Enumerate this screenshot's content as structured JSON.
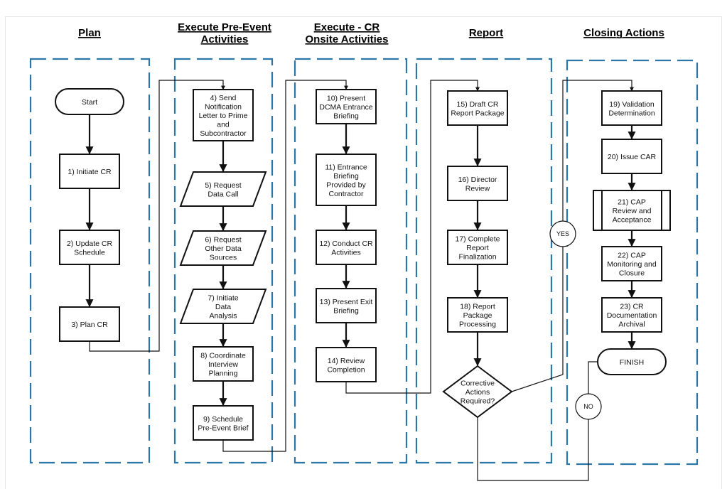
{
  "colors": {
    "lane_border": "#2a76a8",
    "line": "#111111",
    "background": "#ffffff"
  },
  "lanes": [
    {
      "id": "plan",
      "title_lines": [
        "Plan"
      ]
    },
    {
      "id": "pre-event",
      "title_lines": [
        "Execute Pre-Event",
        "Activities"
      ]
    },
    {
      "id": "onsite",
      "title_lines": [
        "Execute - CR",
        "Onsite Activities"
      ]
    },
    {
      "id": "report",
      "title_lines": [
        "Report"
      ]
    },
    {
      "id": "closing",
      "title_lines": [
        "Closing Actions"
      ]
    }
  ],
  "nodes": [
    {
      "id": "start",
      "lane": "plan",
      "shape": "terminator",
      "lines": [
        "Start"
      ]
    },
    {
      "id": "n1",
      "lane": "plan",
      "shape": "process",
      "lines": [
        "1) Initiate CR"
      ]
    },
    {
      "id": "n2",
      "lane": "plan",
      "shape": "process",
      "lines": [
        "2) Update CR",
        "Schedule"
      ]
    },
    {
      "id": "n3",
      "lane": "plan",
      "shape": "process",
      "lines": [
        "3) Plan CR"
      ]
    },
    {
      "id": "n4",
      "lane": "pre-event",
      "shape": "process",
      "lines": [
        "4) Send",
        "Notification",
        "Letter to Prime",
        "and",
        "Subcontractor"
      ]
    },
    {
      "id": "n5",
      "lane": "pre-event",
      "shape": "data",
      "lines": [
        "5) Request",
        "Data Call"
      ]
    },
    {
      "id": "n6",
      "lane": "pre-event",
      "shape": "data",
      "lines": [
        "6) Request",
        "Other Data",
        "Sources"
      ]
    },
    {
      "id": "n7",
      "lane": "pre-event",
      "shape": "data",
      "lines": [
        "7) Initiate",
        "Data",
        "Analysis"
      ]
    },
    {
      "id": "n8",
      "lane": "pre-event",
      "shape": "process",
      "lines": [
        "8) Coordinate",
        "Interview",
        "Planning"
      ]
    },
    {
      "id": "n9",
      "lane": "pre-event",
      "shape": "process",
      "lines": [
        "9) Schedule",
        "Pre-Event Brief"
      ]
    },
    {
      "id": "n10",
      "lane": "onsite",
      "shape": "process",
      "lines": [
        "10) Present",
        "DCMA Entrance",
        "Briefing"
      ]
    },
    {
      "id": "n11",
      "lane": "onsite",
      "shape": "process",
      "lines": [
        "11) Entrance",
        "Briefing",
        "Provided by",
        "Contractor"
      ]
    },
    {
      "id": "n12",
      "lane": "onsite",
      "shape": "process",
      "lines": [
        "12) Conduct CR",
        "Activities"
      ]
    },
    {
      "id": "n13",
      "lane": "onsite",
      "shape": "process",
      "lines": [
        "13) Present Exit",
        "Briefing"
      ]
    },
    {
      "id": "n14",
      "lane": "onsite",
      "shape": "process",
      "lines": [
        "14) Review",
        "Completion"
      ]
    },
    {
      "id": "n15",
      "lane": "report",
      "shape": "process",
      "lines": [
        "15) Draft CR",
        "Report Package"
      ]
    },
    {
      "id": "n16",
      "lane": "report",
      "shape": "process",
      "lines": [
        "16) Director",
        "Review"
      ]
    },
    {
      "id": "n17",
      "lane": "report",
      "shape": "process",
      "lines": [
        "17) Complete",
        "Report",
        "Finalization"
      ]
    },
    {
      "id": "n18",
      "lane": "report",
      "shape": "process",
      "lines": [
        "18) Report",
        "Package",
        "Processing"
      ]
    },
    {
      "id": "decision",
      "lane": "report",
      "shape": "decision",
      "lines": [
        "Corrective",
        "Actions",
        "Required?"
      ]
    },
    {
      "id": "n19",
      "lane": "closing",
      "shape": "process",
      "lines": [
        "19) Validation",
        "Determination"
      ]
    },
    {
      "id": "n20",
      "lane": "closing",
      "shape": "process",
      "lines": [
        "20) Issue CAR"
      ]
    },
    {
      "id": "n21",
      "lane": "closing",
      "shape": "predefined",
      "lines": [
        "21) CAP",
        "Review and",
        "Acceptance"
      ]
    },
    {
      "id": "n22",
      "lane": "closing",
      "shape": "process",
      "lines": [
        "22) CAP",
        "Monitoring and",
        "Closure"
      ]
    },
    {
      "id": "n23",
      "lane": "closing",
      "shape": "process",
      "lines": [
        "23) CR",
        "Documentation",
        "Archival"
      ]
    },
    {
      "id": "finish",
      "lane": "closing",
      "shape": "terminator",
      "lines": [
        "FINISH"
      ]
    }
  ],
  "edges": [
    {
      "from": "start",
      "to": "n1"
    },
    {
      "from": "n1",
      "to": "n2"
    },
    {
      "from": "n2",
      "to": "n3"
    },
    {
      "from": "n3",
      "to": "n4"
    },
    {
      "from": "n4",
      "to": "n5"
    },
    {
      "from": "n5",
      "to": "n6"
    },
    {
      "from": "n6",
      "to": "n7"
    },
    {
      "from": "n7",
      "to": "n8"
    },
    {
      "from": "n8",
      "to": "n9"
    },
    {
      "from": "n9",
      "to": "n10"
    },
    {
      "from": "n10",
      "to": "n11"
    },
    {
      "from": "n11",
      "to": "n12"
    },
    {
      "from": "n12",
      "to": "n13"
    },
    {
      "from": "n13",
      "to": "n14"
    },
    {
      "from": "n14",
      "to": "n15"
    },
    {
      "from": "n15",
      "to": "n16"
    },
    {
      "from": "n16",
      "to": "n17"
    },
    {
      "from": "n17",
      "to": "n18"
    },
    {
      "from": "n18",
      "to": "decision"
    },
    {
      "from": "decision",
      "to": "n19",
      "label": "YES"
    },
    {
      "from": "n19",
      "to": "n20"
    },
    {
      "from": "n20",
      "to": "n21"
    },
    {
      "from": "n21",
      "to": "n22"
    },
    {
      "from": "n22",
      "to": "n23"
    },
    {
      "from": "n23",
      "to": "finish"
    },
    {
      "from": "decision",
      "to": "finish",
      "label": "NO"
    }
  ]
}
